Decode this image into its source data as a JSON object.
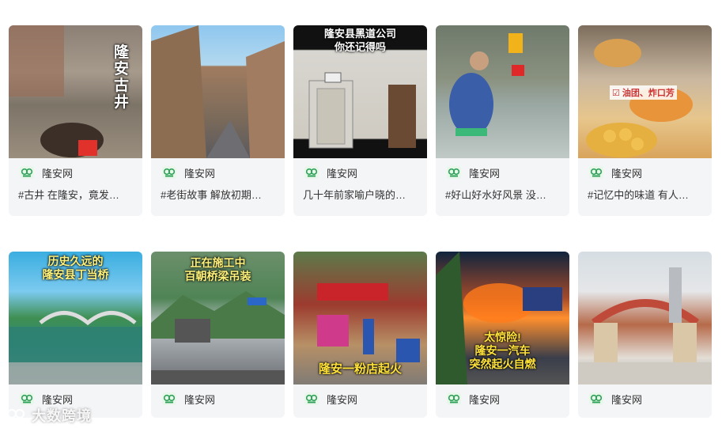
{
  "colors": {
    "card_bg": "#f4f5f7",
    "text": "#333333",
    "icon_bg": "#e9f6ea",
    "icon_fg": "#2fa35a"
  },
  "row1": [
    {
      "overlay": "隆安古井",
      "account": "隆安网",
      "desc": "#古井 在隆安，竟发…",
      "icon": "account-logo-icon"
    },
    {
      "overlay": "",
      "account": "隆安网",
      "desc": "#老街故事 解放初期…",
      "icon": "account-logo-icon"
    },
    {
      "overlay": "隆安县黑道公司\n你还记得吗",
      "account": "隆安网",
      "desc": "几十年前家喻户晓的…",
      "icon": "account-logo-icon"
    },
    {
      "overlay": "",
      "account": "隆安网",
      "desc": "#好山好水好风景 没…",
      "icon": "account-logo-icon"
    },
    {
      "overlay": "油团、炸口芳",
      "account": "隆安网",
      "desc": "#记忆中的味道 有人…",
      "icon": "account-logo-icon"
    }
  ],
  "row2": [
    {
      "overlay": "历史久远的\n隆安县丁当桥",
      "account": "隆安网"
    },
    {
      "overlay": "正在施工中\n百朝桥梁吊装",
      "account": "隆安网"
    },
    {
      "overlay": "隆安一粉店起火",
      "account": "隆安网"
    },
    {
      "overlay": "太惊险!\n隆安一汽车\n突然起火自燃",
      "account": "隆安网"
    },
    {
      "overlay": "",
      "account": "隆安网"
    }
  ],
  "watermark": "大数跨境"
}
